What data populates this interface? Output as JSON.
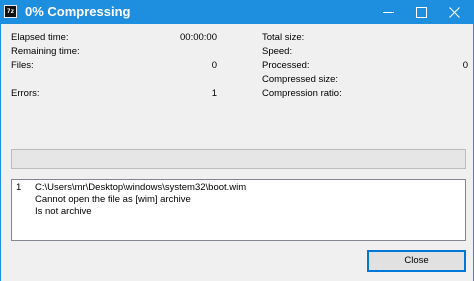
{
  "window": {
    "icon_text": "7z",
    "title": "0% Compressing"
  },
  "stats_left": [
    {
      "label": "Elapsed time:",
      "value": "00:00:00"
    },
    {
      "label": "Remaining time:",
      "value": ""
    },
    {
      "label": "Files:",
      "value": "0"
    },
    {
      "label": "Errors:",
      "value": "1"
    }
  ],
  "stats_right": [
    {
      "label": "Total size:",
      "value": ""
    },
    {
      "label": "Speed:",
      "value": ""
    },
    {
      "label": "Processed:",
      "value": "0"
    },
    {
      "label": "Compressed size:",
      "value": ""
    },
    {
      "label": "Compression ratio:",
      "value": ""
    }
  ],
  "progress": {
    "percent": 0
  },
  "log": {
    "number": "1",
    "path": "C:\\Users\\mr\\Desktop\\windows\\system32\\boot.wim",
    "lines": [
      "Cannot open the file as [wim] archive",
      "Is not archive"
    ]
  },
  "buttons": {
    "close": "Close"
  }
}
